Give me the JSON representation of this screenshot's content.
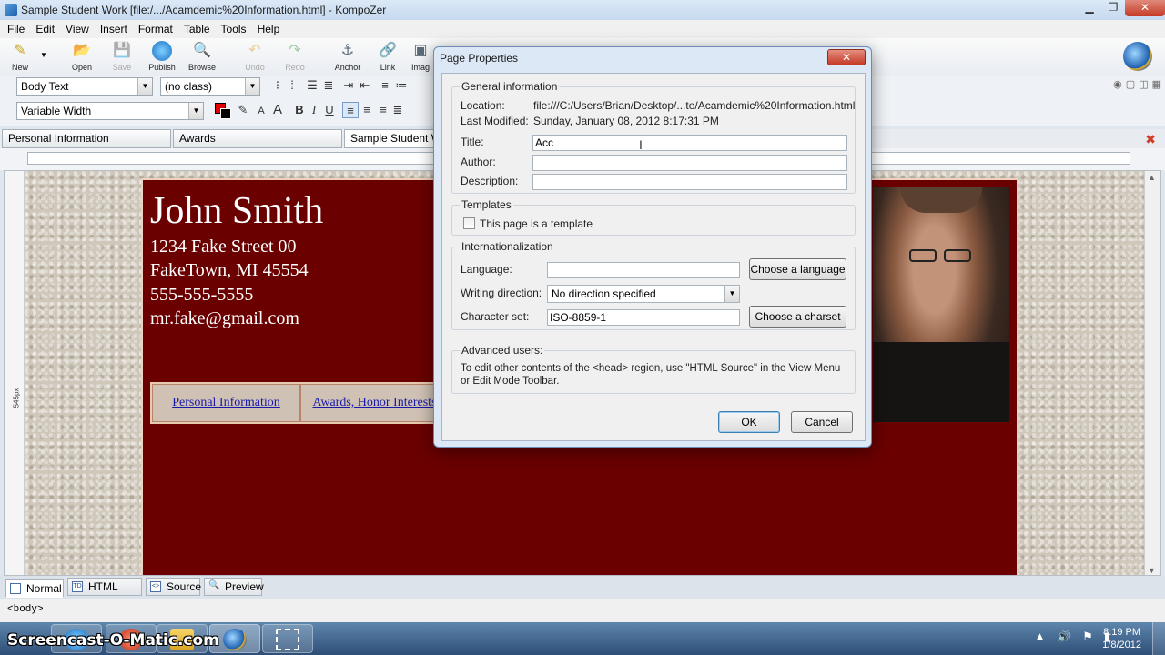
{
  "window": {
    "title": "Sample Student Work [file:/.../Acamdemic%20Information.html] - KompoZer",
    "min": "▁",
    "max": "❐",
    "close": "✕"
  },
  "menu": [
    "File",
    "Edit",
    "View",
    "Insert",
    "Format",
    "Table",
    "Tools",
    "Help"
  ],
  "toolbar": {
    "new": "New",
    "open": "Open",
    "save": "Save",
    "publish": "Publish",
    "browse": "Browse",
    "undo": "Undo",
    "redo": "Redo",
    "anchor": "Anchor",
    "link": "Link",
    "image": "Imag"
  },
  "format": {
    "paragraph_style": "Body Text",
    "class": "(no class)",
    "font": "Variable Width"
  },
  "tabs": [
    "Personal Information",
    "Awards",
    "Sample Student Wo"
  ],
  "ruler_label": "545px",
  "resume": {
    "name": "John Smith",
    "street": "1234 Fake Street 00",
    "city": "FakeTown, MI 45554",
    "phone": "555-555-5555",
    "email": "mr.fake@gmail.com",
    "nav": [
      "Personal Information",
      "Awards, Honor Interests"
    ]
  },
  "modes": [
    "Normal",
    "HTML Tags",
    "Source",
    "Preview"
  ],
  "status": "<body>",
  "taskbar": {
    "watermark": "Screencast-O-Matic.com",
    "time": "8:19 PM",
    "date": "1/8/2012"
  },
  "dialog": {
    "title": "Page Properties",
    "close": "✕",
    "general": {
      "heading": "General information",
      "location_label": "Location:",
      "location": "file:///C:/Users/Brian/Desktop/...te/Acamdemic%20Information.html",
      "modified_label": "Last Modified:",
      "modified": "Sunday, January 08, 2012 8:17:31 PM",
      "title_label": "Title:",
      "title_value": "Acc",
      "author_label": "Author:",
      "author_value": "",
      "description_label": "Description:",
      "description_value": ""
    },
    "templates": {
      "heading": "Templates",
      "checkbox_label": "This page is a template",
      "checked": false
    },
    "i18n": {
      "heading": "Internationalization",
      "language_label": "Language:",
      "language_value": "",
      "choose_language": "Choose a language",
      "direction_label": "Writing direction:",
      "direction_value": "No direction specified",
      "charset_label": "Character set:",
      "charset_value": "ISO-8859-1",
      "choose_charset": "Choose a charset"
    },
    "advanced": {
      "heading": "Advanced users:",
      "text": "To edit other contents of the <head> region, use \"HTML Source\" in the View Menu or Edit Mode Toolbar."
    },
    "ok": "OK",
    "cancel": "Cancel"
  }
}
